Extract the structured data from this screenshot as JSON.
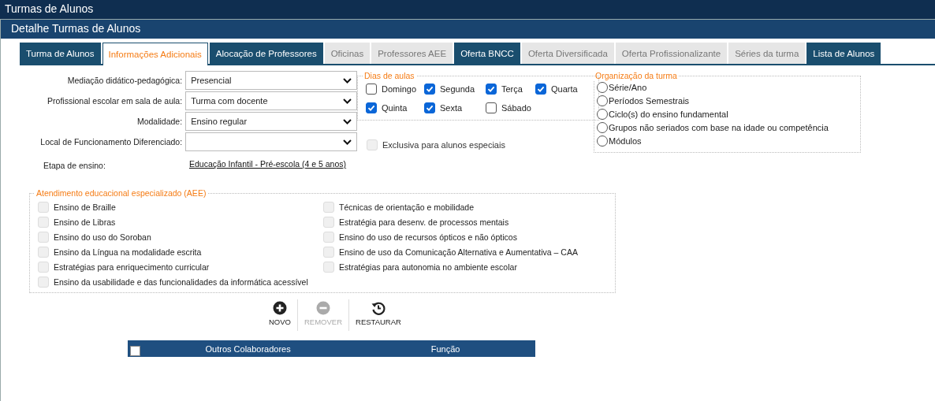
{
  "window": {
    "title": "Turmas de Alunos"
  },
  "panel": {
    "title": "Detalhe Turmas de Alunos"
  },
  "tabs": [
    {
      "label": "Turma de Alunos",
      "selected": false,
      "disabled": false
    },
    {
      "label": "Informações Adicionais",
      "selected": true,
      "disabled": false
    },
    {
      "label": "Alocação de Professores",
      "selected": false,
      "disabled": false
    },
    {
      "label": "Oficinas",
      "selected": false,
      "disabled": true
    },
    {
      "label": "Professores AEE",
      "selected": false,
      "disabled": true
    },
    {
      "label": "Oferta BNCC",
      "selected": false,
      "disabled": false
    },
    {
      "label": "Oferta Diversificada",
      "selected": false,
      "disabled": true
    },
    {
      "label": "Oferta Profissionalizante",
      "selected": false,
      "disabled": true
    },
    {
      "label": "Séries da turma",
      "selected": false,
      "disabled": true
    },
    {
      "label": "Lista de Alunos",
      "selected": false,
      "disabled": false
    }
  ],
  "form": {
    "fields": [
      {
        "kind": "select",
        "label": "Mediação didático-pedagógica:",
        "value": "Presencial"
      },
      {
        "kind": "select",
        "label": "Profissional escolar em sala de aula:",
        "value": "Turma com docente"
      },
      {
        "kind": "select",
        "label": "Modalidade:",
        "value": "Ensino regular"
      },
      {
        "kind": "select",
        "label": "Local de Funcionamento Diferenciado:"
      },
      {
        "kind": "link",
        "label": "Etapa de ensino:",
        "value": "Educação Infantil - Pré-escola (4 e 5 anos)"
      }
    ]
  },
  "dias_de_aulas": {
    "title": "Dias de aulas",
    "days": [
      {
        "label": "Domingo",
        "checked": false
      },
      {
        "label": "Segunda",
        "checked": true
      },
      {
        "label": "Terça",
        "checked": true
      },
      {
        "label": "Quarta",
        "checked": true
      },
      {
        "label": "Quinta",
        "checked": true
      },
      {
        "label": "Sexta",
        "checked": true
      },
      {
        "label": "Sábado",
        "checked": false
      }
    ]
  },
  "exclusiva": {
    "label": "Exclusiva para alunos especiais",
    "checked": false,
    "disabled": true
  },
  "organizacao": {
    "title": "Organização da turma",
    "options": [
      {
        "label": "Série/Ano",
        "selected": false
      },
      {
        "label": "Períodos Semestrais",
        "selected": false
      },
      {
        "label": "Ciclo(s) do ensino fundamental",
        "selected": false
      },
      {
        "label": "Grupos não seriados com base na idade ou competência",
        "selected": false
      },
      {
        "label": "Módulos",
        "selected": false
      }
    ]
  },
  "aee": {
    "title": "Atendimento educacional especializado (AEE)",
    "items": [
      {
        "label": "Ensino de Braille",
        "checked": false,
        "disabled": true
      },
      {
        "label": "Ensino de Libras",
        "checked": false,
        "disabled": true
      },
      {
        "label": "Ensino do uso do Soroban",
        "checked": false,
        "disabled": true
      },
      {
        "label": "Ensino da Língua na modalidade escrita",
        "checked": false,
        "disabled": true
      },
      {
        "label": "Estratégias para enriquecimento curricular",
        "checked": false,
        "disabled": true
      },
      {
        "label": "Ensino da usabilidade e das funcionalidades da informática acessível",
        "checked": false,
        "disabled": true
      },
      {
        "label": "Técnicas de orientação e mobilidade",
        "checked": false,
        "disabled": true
      },
      {
        "label": "Estratégia para desenv. de processos mentais",
        "checked": false,
        "disabled": true
      },
      {
        "label": "Ensino do uso de recursos ópticos e não ópticos",
        "checked": false,
        "disabled": true
      },
      {
        "label": "Ensino de uso da Comunicação Alternativa e Aumentativa – CAA",
        "checked": false,
        "disabled": true
      },
      {
        "label": "Estratégias para autonomia no ambiente escolar",
        "checked": false,
        "disabled": true
      }
    ]
  },
  "toolbar": [
    {
      "kind": "add",
      "label": "NOVO",
      "disabled": false
    },
    {
      "kind": "remove",
      "label": "REMOVER",
      "disabled": true
    },
    {
      "kind": "restore",
      "label": "RESTAURAR",
      "disabled": false
    }
  ],
  "table": {
    "select_all_checked": false,
    "columns": [
      "Outros Colaboradores",
      "Função"
    ]
  }
}
